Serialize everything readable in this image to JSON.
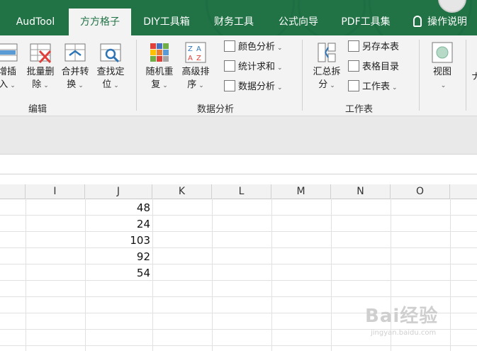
{
  "ribbon": {
    "tabs": [
      {
        "label": "AudTool",
        "active": false
      },
      {
        "label": "方方格子",
        "active": true
      },
      {
        "label": "DIY工具箱",
        "active": false
      },
      {
        "label": "财务工具",
        "active": false
      },
      {
        "label": "公式向导",
        "active": false
      },
      {
        "label": "PDF工具集",
        "active": false
      }
    ],
    "help_label": "操作说明",
    "groups": {
      "edit": {
        "label": "编辑",
        "buttons": [
          {
            "line1": "增插",
            "line2": "入"
          },
          {
            "line1": "批量删",
            "line2": "除"
          },
          {
            "line1": "合并转",
            "line2": "换"
          },
          {
            "line1": "查找定",
            "line2": "位"
          }
        ]
      },
      "data_analysis": {
        "label": "数据分析",
        "buttons": [
          {
            "line1": "随机重",
            "line2": "复"
          },
          {
            "line1": "高级排",
            "line2": "序"
          }
        ],
        "small_buttons": [
          "颜色分析",
          "统计求和",
          "数据分析"
        ]
      },
      "worksheet": {
        "label": "工作表",
        "buttons": [
          {
            "line1": "汇总拆",
            "line2": "分"
          }
        ],
        "small_buttons": [
          "另存本表",
          "表格目录",
          "工作表"
        ]
      },
      "view": {
        "label": "视图"
      },
      "cut_off": "ナ"
    }
  },
  "sheet": {
    "columns": [
      "I",
      "J",
      "K",
      "L",
      "M",
      "N",
      "O"
    ],
    "column_j_values": [
      "48",
      "24",
      "103",
      "92",
      "54"
    ]
  },
  "watermark": {
    "logo": "Bai经验",
    "url": "jingyan.baidu.com"
  },
  "colors": {
    "ribbon_green": "#217346",
    "ribbon_bg": "#f3f3f3",
    "header_bg": "#f2f2f2"
  }
}
